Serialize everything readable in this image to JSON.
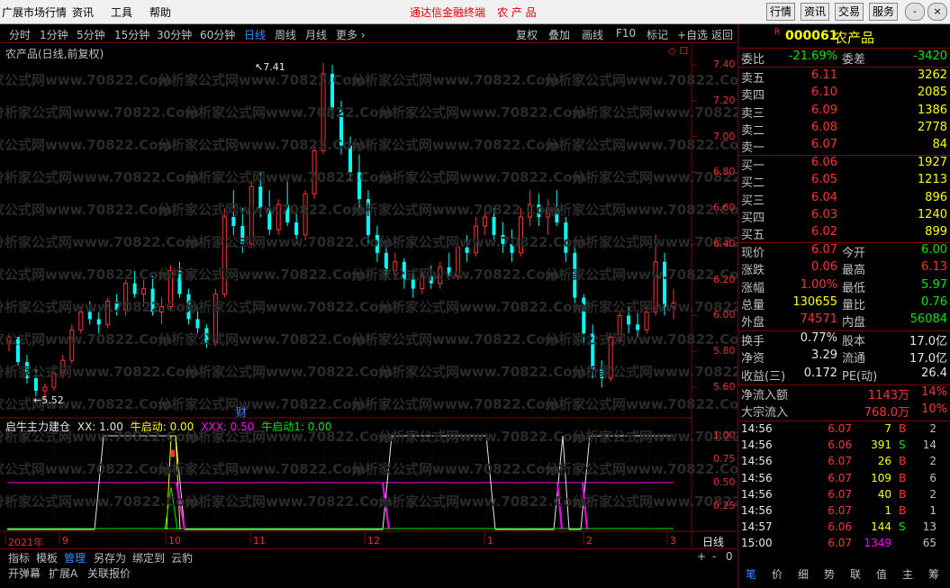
{
  "menu": {
    "items": [
      "广展市场行情",
      "资讯",
      "工具",
      "帮助"
    ],
    "center_title": "通达信金融终端",
    "center_stock": "农 产 品",
    "right_buttons": [
      "行情",
      "资讯",
      "交易",
      "服务"
    ],
    "window_controls": [
      "-",
      "□",
      "×"
    ]
  },
  "periods": {
    "items": [
      "分时",
      "1分钟",
      "5分钟",
      "15分钟",
      "30分钟",
      "60分钟",
      "日线",
      "周线",
      "月线",
      "更多 ›"
    ],
    "active": "日线"
  },
  "toolbar": {
    "items": [
      "复权",
      "叠加",
      "画线",
      "F10",
      "标记",
      "+自选",
      "返回"
    ]
  },
  "chart": {
    "title": "农产品(日线,前复权)",
    "y_labels": [
      "7.40",
      "7.20",
      "7.00",
      "6.80",
      "6.60",
      "6.40",
      "6.20",
      "6.00",
      "5.80",
      "5.60"
    ],
    "high_marker": "7.41",
    "low_marker": "5.52",
    "event_marker": "财",
    "x_labels": [
      "2021年",
      "9",
      "10",
      "11",
      "12",
      "1",
      "2",
      "3"
    ],
    "period_label": "日线",
    "watermark": "分析家公式网www.70822.Com"
  },
  "chart_data": {
    "type": "candlestick",
    "title": "农产品(日线,前复权)",
    "ylim": [
      5.5,
      7.45
    ],
    "high": 7.41,
    "low": 5.52,
    "candles": [
      [
        5.85,
        5.9,
        5.8,
        5.88
      ],
      [
        5.88,
        5.88,
        5.72,
        5.74
      ],
      [
        5.74,
        5.78,
        5.62,
        5.65
      ],
      [
        5.65,
        5.7,
        5.55,
        5.58
      ],
      [
        5.58,
        5.62,
        5.52,
        5.6
      ],
      [
        5.6,
        5.7,
        5.58,
        5.68
      ],
      [
        5.68,
        5.78,
        5.65,
        5.75
      ],
      [
        5.75,
        5.95,
        5.73,
        5.92
      ],
      [
        5.92,
        6.05,
        5.9,
        6.02
      ],
      [
        6.02,
        6.08,
        5.95,
        5.98
      ],
      [
        5.98,
        6.02,
        5.9,
        5.95
      ],
      [
        5.95,
        6.1,
        5.93,
        6.08
      ],
      [
        6.08,
        6.12,
        6.0,
        6.03
      ],
      [
        6.03,
        6.2,
        6.0,
        6.18
      ],
      [
        6.18,
        6.25,
        6.1,
        6.12
      ],
      [
        6.12,
        6.2,
        6.05,
        6.15
      ],
      [
        6.15,
        6.22,
        6.0,
        6.02
      ],
      [
        6.02,
        6.1,
        5.95,
        6.05
      ],
      [
        6.05,
        6.28,
        6.03,
        6.25
      ],
      [
        6.25,
        6.3,
        6.1,
        6.12
      ],
      [
        6.12,
        6.15,
        5.95,
        5.98
      ],
      [
        5.98,
        6.05,
        5.9,
        5.93
      ],
      [
        5.93,
        5.95,
        5.82,
        5.85
      ],
      [
        5.85,
        6.15,
        5.83,
        6.12
      ],
      [
        6.12,
        6.6,
        6.1,
        6.55
      ],
      [
        6.55,
        6.7,
        6.45,
        6.5
      ],
      [
        6.5,
        6.6,
        6.35,
        6.4
      ],
      [
        6.4,
        6.75,
        6.38,
        6.72
      ],
      [
        6.72,
        6.8,
        6.55,
        6.6
      ],
      [
        6.6,
        6.7,
        6.45,
        6.48
      ],
      [
        6.48,
        6.65,
        6.45,
        6.62
      ],
      [
        6.62,
        6.75,
        6.5,
        6.52
      ],
      [
        6.52,
        6.6,
        6.4,
        6.45
      ],
      [
        6.45,
        6.7,
        6.42,
        6.68
      ],
      [
        6.68,
        6.95,
        6.65,
        6.92
      ],
      [
        6.92,
        7.41,
        6.9,
        7.35
      ],
      [
        7.35,
        7.4,
        7.1,
        7.15
      ],
      [
        7.15,
        7.2,
        6.9,
        6.95
      ],
      [
        6.95,
        7.0,
        6.75,
        6.8
      ],
      [
        6.8,
        6.9,
        6.6,
        6.65
      ],
      [
        6.65,
        6.7,
        6.4,
        6.45
      ],
      [
        6.45,
        6.5,
        6.3,
        6.35
      ],
      [
        6.35,
        6.4,
        6.2,
        6.25
      ],
      [
        6.25,
        6.35,
        6.2,
        6.3
      ],
      [
        6.3,
        6.32,
        6.15,
        6.2
      ],
      [
        6.2,
        6.25,
        6.1,
        6.15
      ],
      [
        6.15,
        6.25,
        6.12,
        6.22
      ],
      [
        6.22,
        6.28,
        6.15,
        6.18
      ],
      [
        6.18,
        6.3,
        6.15,
        6.27
      ],
      [
        6.27,
        6.35,
        6.2,
        6.22
      ],
      [
        6.22,
        6.4,
        6.2,
        6.38
      ],
      [
        6.38,
        6.45,
        6.3,
        6.35
      ],
      [
        6.35,
        6.55,
        6.33,
        6.5
      ],
      [
        6.5,
        6.6,
        6.45,
        6.55
      ],
      [
        6.55,
        6.6,
        6.4,
        6.45
      ],
      [
        6.45,
        6.52,
        6.35,
        6.4
      ],
      [
        6.4,
        6.48,
        6.3,
        6.35
      ],
      [
        6.35,
        6.6,
        6.33,
        6.55
      ],
      [
        6.55,
        6.7,
        6.5,
        6.62
      ],
      [
        6.62,
        6.68,
        6.5,
        6.55
      ],
      [
        6.55,
        6.65,
        6.45,
        6.6
      ],
      [
        6.6,
        6.7,
        6.5,
        6.52
      ],
      [
        6.52,
        6.55,
        6.3,
        6.35
      ],
      [
        6.35,
        6.4,
        6.05,
        6.1
      ],
      [
        6.1,
        6.12,
        5.85,
        5.9
      ],
      [
        5.9,
        5.95,
        5.65,
        5.7
      ],
      [
        5.7,
        5.75,
        5.6,
        5.65
      ],
      [
        5.65,
        5.9,
        5.63,
        5.88
      ],
      [
        5.88,
        6.02,
        5.85,
        6.0
      ],
      [
        6.0,
        6.05,
        5.9,
        5.95
      ],
      [
        5.95,
        6.02,
        5.88,
        5.92
      ],
      [
        5.92,
        6.05,
        5.9,
        6.02
      ],
      [
        6.02,
        6.45,
        6.0,
        6.3
      ],
      [
        6.3,
        6.35,
        6.0,
        6.05
      ],
      [
        6.05,
        6.15,
        5.98,
        6.07
      ]
    ]
  },
  "indicator": {
    "name": "启牛主力建仓",
    "series": [
      {
        "name": "XX",
        "value": "1.00"
      },
      {
        "name": "牛启动",
        "value": "0.00"
      },
      {
        "name": "XXX",
        "value": "0.50"
      },
      {
        "name": "牛启动1",
        "value": "0.00"
      }
    ],
    "y_labels": [
      "1.00",
      "0.75",
      "0.50",
      "0.25"
    ]
  },
  "bottom_tabs1": [
    "指标",
    "模板",
    "管理",
    "另存为",
    "绑定到",
    "云豹"
  ],
  "bottom_tabs1_active": "管理",
  "bottom_tabs2": [
    "开弹幕",
    "扩展A",
    "关联报价"
  ],
  "bottom_right_controls": [
    "+",
    "-",
    "0"
  ],
  "quote": {
    "code": "000061",
    "name": "农产品",
    "r_mark": "R",
    "weibi": {
      "label": "委比",
      "value": "-21.69%",
      "label2": "委差",
      "value2": "-3420"
    },
    "asks": [
      {
        "label": "卖五",
        "price": "6.11",
        "vol": "3262"
      },
      {
        "label": "卖四",
        "price": "6.10",
        "vol": "2085"
      },
      {
        "label": "卖三",
        "price": "6.09",
        "vol": "1386"
      },
      {
        "label": "卖二",
        "price": "6.08",
        "vol": "2778"
      },
      {
        "label": "卖一",
        "price": "6.07",
        "vol": "84"
      }
    ],
    "bids": [
      {
        "label": "买一",
        "price": "6.06",
        "vol": "1927"
      },
      {
        "label": "买二",
        "price": "6.05",
        "vol": "1213"
      },
      {
        "label": "买三",
        "price": "6.04",
        "vol": "896"
      },
      {
        "label": "买四",
        "price": "6.03",
        "vol": "1240"
      },
      {
        "label": "买五",
        "price": "6.02",
        "vol": "899"
      }
    ],
    "stats": [
      {
        "l1": "现价",
        "v1": "6.07",
        "c1": "red",
        "l2": "今开",
        "v2": "6.00",
        "c2": "green"
      },
      {
        "l1": "涨跌",
        "v1": "0.06",
        "c1": "red",
        "l2": "最高",
        "v2": "6.13",
        "c2": "red"
      },
      {
        "l1": "涨幅",
        "v1": "1.00%",
        "c1": "red",
        "l2": "最低",
        "v2": "5.97",
        "c2": "green"
      },
      {
        "l1": "总量",
        "v1": "130655",
        "c1": "yellow",
        "l2": "量比",
        "v2": "0.76",
        "c2": "green"
      },
      {
        "l1": "外盘",
        "v1": "74571",
        "c1": "red",
        "l2": "内盘",
        "v2": "56084",
        "c2": "green"
      }
    ],
    "stats2": [
      {
        "l1": "换手",
        "v1": "0.77%",
        "l2": "股本",
        "v2": "17.0亿"
      },
      {
        "l1": "净资",
        "v1": "3.29",
        "l2": "流通",
        "v2": "17.0亿"
      },
      {
        "l1": "收益(三)",
        "v1": "0.172",
        "l2": "PE(动)",
        "v2": "26.4"
      }
    ],
    "flows": [
      {
        "label": "净流入额",
        "value": "1143万",
        "pct": "14%"
      },
      {
        "label": "大宗流入",
        "value": "768.0万",
        "pct": "10%"
      }
    ],
    "ticks": [
      {
        "time": "14:56",
        "price": "6.07",
        "pc": "red",
        "vol": "7",
        "vc": "yellow",
        "side": "B",
        "sc": "red",
        "num": "2"
      },
      {
        "time": "14:56",
        "price": "6.06",
        "pc": "red",
        "vol": "391",
        "vc": "yellow",
        "side": "S",
        "sc": "green",
        "num": "14"
      },
      {
        "time": "14:56",
        "price": "6.07",
        "pc": "red",
        "vol": "26",
        "vc": "yellow",
        "side": "B",
        "sc": "red",
        "num": "2"
      },
      {
        "time": "14:56",
        "price": "6.07",
        "pc": "red",
        "vol": "109",
        "vc": "yellow",
        "side": "B",
        "sc": "red",
        "num": "6"
      },
      {
        "time": "14:56",
        "price": "6.07",
        "pc": "red",
        "vol": "40",
        "vc": "yellow",
        "side": "B",
        "sc": "red",
        "num": "2"
      },
      {
        "time": "14:56",
        "price": "6.07",
        "pc": "red",
        "vol": "1",
        "vc": "yellow",
        "side": "B",
        "sc": "red",
        "num": "1"
      },
      {
        "time": "14:57",
        "price": "6.06",
        "pc": "red",
        "vol": "144",
        "vc": "yellow",
        "side": "S",
        "sc": "green",
        "num": "13"
      },
      {
        "time": "15:00",
        "price": "6.07",
        "pc": "red",
        "vol": "1349",
        "vc": "magenta",
        "side": "",
        "sc": "red",
        "num": "65"
      }
    ],
    "tabs": [
      "笔",
      "价",
      "细",
      "势",
      "联",
      "值",
      "主",
      "筹"
    ],
    "active_tab": "笔"
  },
  "colors": {
    "up": "#ff3232",
    "down": "#00ffff",
    "grid": "#800000",
    "accent": "#3a8cff"
  }
}
